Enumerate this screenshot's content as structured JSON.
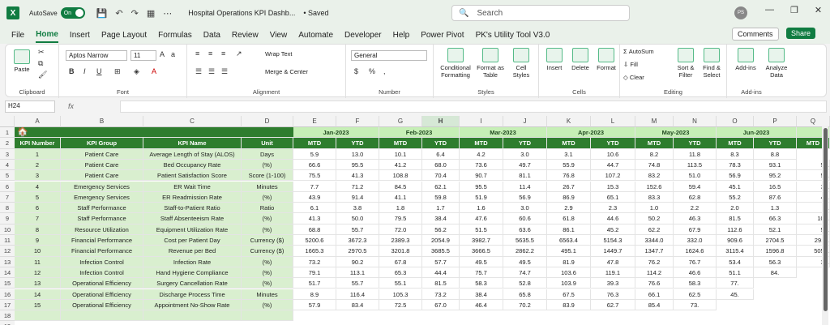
{
  "titlebar": {
    "app_icon": "X",
    "autosave_label": "AutoSave",
    "autosave_state": "On",
    "doc_title": "Hospital Operations KPI Dashb...",
    "saved_status": "• Saved",
    "avatar": "PS"
  },
  "search": {
    "placeholder": "Search"
  },
  "menu": {
    "tabs": [
      "File",
      "Home",
      "Insert",
      "Page Layout",
      "Formulas",
      "Data",
      "Review",
      "View",
      "Automate",
      "Developer",
      "Help",
      "Power Pivot",
      "PK's Utility Tool V3.0"
    ],
    "comments": "Comments",
    "share": "Share"
  },
  "ribbon": {
    "clipboard": {
      "name": "Clipboard",
      "paste": "Paste"
    },
    "font": {
      "name": "Font",
      "family": "Aptos Narrow",
      "size": "11"
    },
    "alignment": {
      "name": "Alignment",
      "wrap": "Wrap Text",
      "merge": "Merge & Center"
    },
    "number": {
      "name": "Number",
      "format": "General"
    },
    "styles": {
      "name": "Styles",
      "conditional": "Conditional Formatting",
      "format_table": "Format as Table",
      "cell_styles": "Cell Styles"
    },
    "cells": {
      "name": "Cells",
      "insert": "Insert",
      "delete": "Delete",
      "format": "Format"
    },
    "editing": {
      "name": "Editing",
      "autosum": "AutoSum",
      "fill": "Fill",
      "clear": "Clear",
      "sort": "Sort & Filter",
      "find": "Find & Select"
    },
    "addins": {
      "name": "Add-ins",
      "addins": "Add-ins",
      "analyze": "Analyze Data"
    }
  },
  "formula": {
    "namebox": "H24",
    "fx": "fx"
  },
  "columns": [
    "A",
    "B",
    "C",
    "D",
    "E",
    "F",
    "G",
    "H",
    "I",
    "J",
    "K",
    "L",
    "M",
    "N",
    "O",
    "P",
    "Q"
  ],
  "months": [
    "Jan-2023",
    "Feb-2023",
    "Mar-2023",
    "Apr-2023",
    "May-2023",
    "Jun-2023"
  ],
  "headers": [
    "KPI Number",
    "KPI Group",
    "KPI Name",
    "Unit"
  ],
  "subheaders": [
    "MTD",
    "YTD"
  ],
  "rows": [
    [
      "1",
      "Patient Care",
      "Average Length of Stay (ALOS)",
      "Days",
      "5.9",
      "13.0",
      "10.1",
      "6.4",
      "4.2",
      "3.0",
      "3.1",
      "10.6",
      "8.2",
      "11.8",
      "8.3",
      "8.8"
    ],
    [
      "2",
      "Patient Care",
      "Bed Occupancy Rate",
      "(%)",
      "66.6",
      "95.5",
      "41.2",
      "68.0",
      "73.6",
      "49.7",
      "55.9",
      "44.7",
      "74.8",
      "113.5",
      "78.3",
      "93.1",
      "57."
    ],
    [
      "3",
      "Patient Care",
      "Patient Satisfaction Score",
      "Score (1-100)",
      "75.5",
      "41.3",
      "108.8",
      "70.4",
      "90.7",
      "81.1",
      "76.8",
      "107.2",
      "83.2",
      "51.0",
      "56.9",
      "95.2",
      "58."
    ],
    [
      "4",
      "Emergency Services",
      "ER Wait Time",
      "Minutes",
      "7.7",
      "71.2",
      "84.5",
      "62.1",
      "95.5",
      "11.4",
      "26.7",
      "15.3",
      "152.6",
      "59.4",
      "45.1",
      "16.5",
      "34."
    ],
    [
      "5",
      "Emergency Services",
      "ER Readmission Rate",
      "(%)",
      "43.9",
      "91.4",
      "41.1",
      "59.8",
      "51.9",
      "56.9",
      "86.9",
      "65.1",
      "83.3",
      "62.8",
      "55.2",
      "87.6",
      "40."
    ],
    [
      "6",
      "Staff Performance",
      "Staff-to-Patient Ratio",
      "Ratio",
      "6.1",
      "3.8",
      "1.8",
      "1.7",
      "1.6",
      "3.0",
      "2.9",
      "2.3",
      "1.0",
      "2.2",
      "2.0",
      "1.3",
      "6."
    ],
    [
      "7",
      "Staff Performance",
      "Staff Absenteeism Rate",
      "(%)",
      "41.3",
      "50.0",
      "79.5",
      "38.4",
      "47.6",
      "60.6",
      "61.8",
      "44.6",
      "50.2",
      "46.3",
      "81.5",
      "66.3",
      "109."
    ],
    [
      "8",
      "Resource Utilization",
      "Equipment Utilization Rate",
      "(%)",
      "68.8",
      "55.7",
      "72.0",
      "56.2",
      "51.5",
      "63.6",
      "86.1",
      "45.2",
      "62.2",
      "67.9",
      "112.6",
      "52.1",
      "53."
    ],
    [
      "9",
      "Financial Performance",
      "Cost per Patient Day",
      "Currency ($)",
      "5200.6",
      "3672.3",
      "2389.3",
      "2054.9",
      "3982.7",
      "5635.5",
      "6563.4",
      "5154.3",
      "3344.0",
      "332.0",
      "909.6",
      "2704.5",
      "2911."
    ],
    [
      "10",
      "Financial Performance",
      "Revenue per Bed",
      "Currency ($)",
      "1665.3",
      "2970.5",
      "3201.8",
      "3685.5",
      "3666.5",
      "2862.2",
      "495.1",
      "1449.7",
      "1347.7",
      "1624.6",
      "3115.4",
      "1596.8",
      "5054."
    ],
    [
      "11",
      "Infection Control",
      "Infection Rate",
      "(%)",
      "73.2",
      "90.2",
      "67.8",
      "57.7",
      "49.5",
      "49.5",
      "81.9",
      "47.8",
      "76.2",
      "76.7",
      "53.4",
      "56.3",
      "36."
    ],
    [
      "12",
      "Infection Control",
      "Hand Hygiene Compliance",
      "(%)",
      "79.1",
      "113.1",
      "65.3",
      "44.4",
      "75.7",
      "74.7",
      "103.6",
      "119.1",
      "114.2",
      "46.6",
      "51.1",
      "84."
    ],
    [
      "13",
      "Operational Efficiency",
      "Surgery Cancellation Rate",
      "(%)",
      "51.7",
      "55.7",
      "55.1",
      "81.5",
      "58.3",
      "52.8",
      "103.9",
      "39.3",
      "76.6",
      "58.3",
      "77."
    ],
    [
      "14",
      "Operational Efficiency",
      "Discharge Process Time",
      "Minutes",
      "8.9",
      "116.4",
      "105.3",
      "73.2",
      "38.4",
      "65.8",
      "67.5",
      "76.3",
      "66.1",
      "62.5",
      "45."
    ],
    [
      "15",
      "Operational Efficiency",
      "Appointment No-Show Rate",
      "(%)",
      "57.9",
      "83.4",
      "72.5",
      "67.0",
      "46.4",
      "70.2",
      "83.9",
      "62.7",
      "85.4",
      "73."
    ]
  ]
}
